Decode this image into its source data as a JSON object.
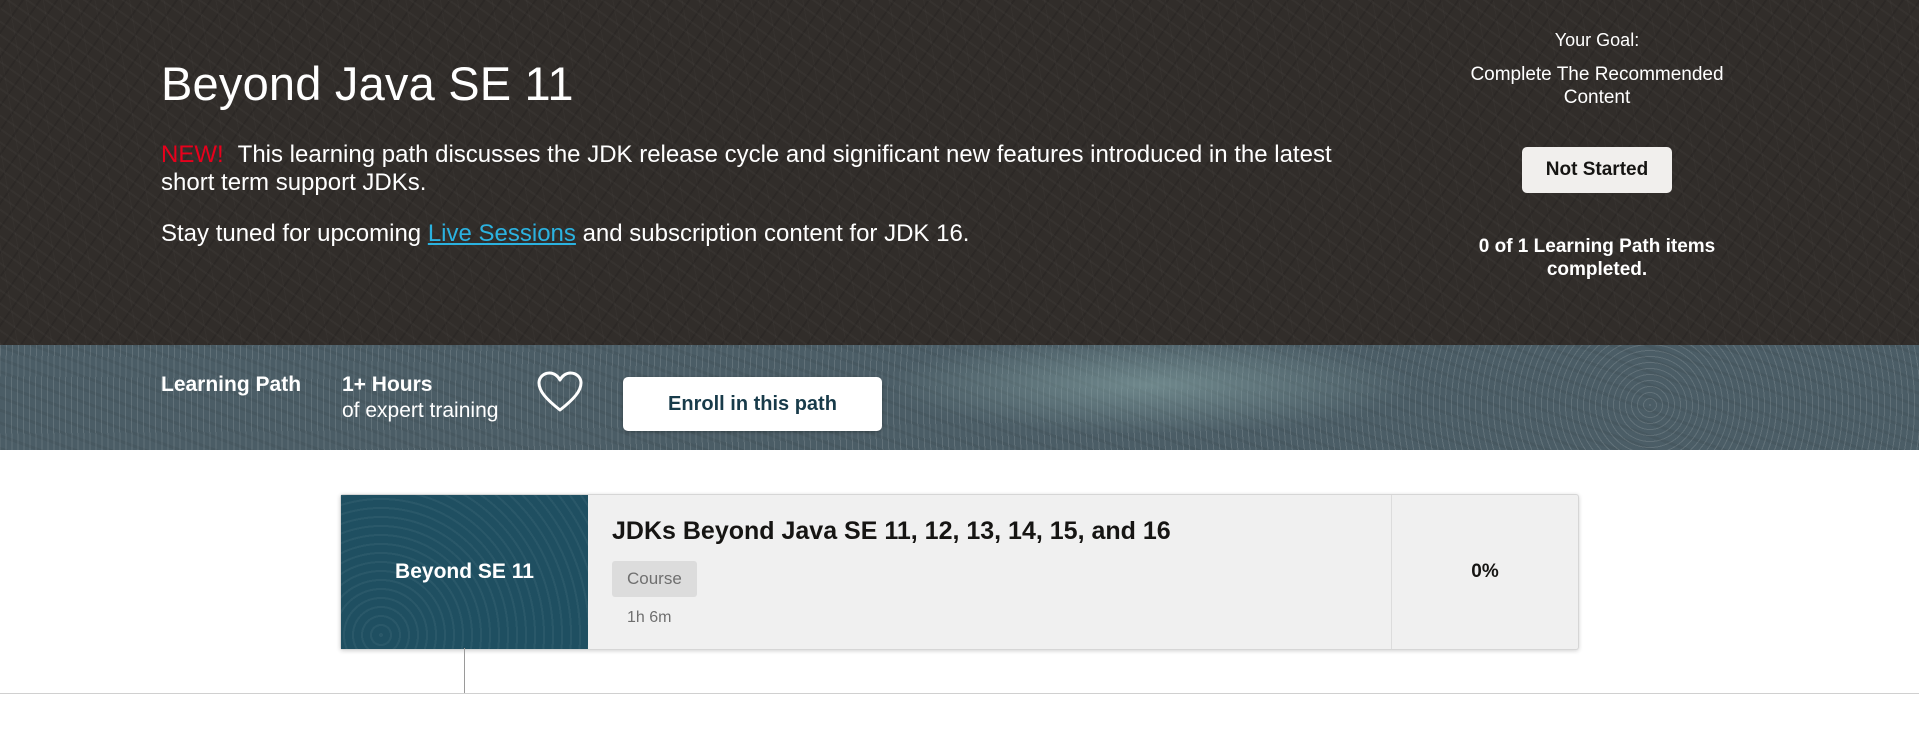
{
  "hero": {
    "title": "Beyond Java SE 11",
    "new_badge": "NEW!",
    "description": "This learning path discusses the JDK release cycle and significant new features introduced in the latest short term support JDKs.",
    "stay_prefix": "Stay tuned for upcoming",
    "stay_link": "Live Sessions",
    "stay_suffix": "and subscription content for JDK 16."
  },
  "goal": {
    "label": "Your Goal:",
    "value": "Complete The Recommended Content",
    "status_button": "Not Started",
    "progress_text": "0 of 1 Learning Path items completed."
  },
  "meta": {
    "type_label": "Learning Path",
    "hours": "1+ Hours",
    "hours_sub": "of expert training",
    "favorite_icon": "heart-icon",
    "enroll_button": "Enroll in this path"
  },
  "course_card": {
    "thumb_label": "Beyond SE 11",
    "title": "JDKs Beyond Java SE 11, 12, 13, 14, 15, and 16",
    "tag": "Course",
    "duration": "1h 6m",
    "progress": "0%"
  },
  "colors": {
    "hero_bg": "#312d2a",
    "new_badge": "#e8001c",
    "link": "#2bb2e0",
    "band_bg": "#4b5d66",
    "thumb_bg": "#1f4f61"
  }
}
